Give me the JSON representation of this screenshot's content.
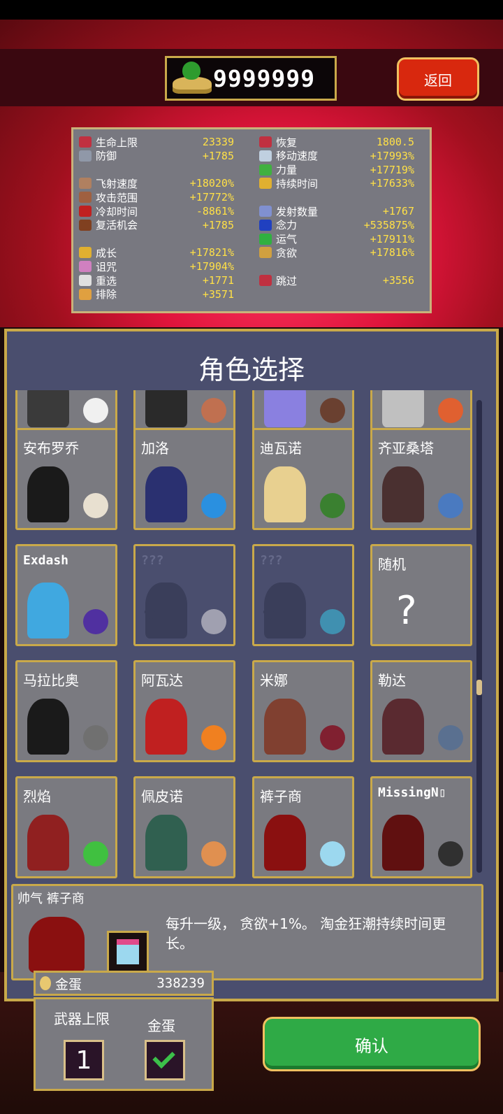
{
  "currency": {
    "value": "9999999",
    "icon": "gold-coin-bag-icon"
  },
  "back_label": "返回",
  "stats": {
    "left": [
      {
        "label": "生命上限",
        "value": "23339",
        "icon": "heart-icon",
        "color": "#c03040"
      },
      {
        "label": "防御",
        "value": "+1785",
        "icon": "armor-icon",
        "color": "#9098a8"
      },
      {
        "label": "飞射速度",
        "value": "+18020%",
        "icon": "wing-icon",
        "color": "#b08060"
      },
      {
        "label": "攻击范围",
        "value": "+17772%",
        "icon": "area-icon",
        "color": "#a06040"
      },
      {
        "label": "冷却时间",
        "value": "-8861%",
        "icon": "cooldown-icon",
        "color": "#c02020"
      },
      {
        "label": "复活机会",
        "value": "+1785",
        "icon": "revival-icon",
        "color": "#804020"
      },
      {
        "label": "成长",
        "value": "+17821%",
        "icon": "crown-icon",
        "color": "#e0b030"
      },
      {
        "label": "诅咒",
        "value": "+17904%",
        "icon": "skull-icon",
        "color": "#d080c0"
      },
      {
        "label": "重选",
        "value": "+1771",
        "icon": "dice-icon",
        "color": "#e0e0e0"
      },
      {
        "label": "排除",
        "value": "+3571",
        "icon": "banish-icon",
        "color": "#e0a040"
      }
    ],
    "right": [
      {
        "label": "恢复",
        "value": "1800.5",
        "icon": "recovery-heart-icon",
        "color": "#c03040"
      },
      {
        "label": "移动速度",
        "value": "+17993%",
        "icon": "wing-speed-icon",
        "color": "#c0d0e0"
      },
      {
        "label": "力量",
        "value": "+17719%",
        "icon": "leaf-icon",
        "color": "#40b040"
      },
      {
        "label": "持续时间",
        "value": "+17633%",
        "icon": "hourglass-icon",
        "color": "#e0b030"
      },
      {
        "label": "发射数量",
        "value": "+1767",
        "icon": "amount-icon",
        "color": "#8090d0"
      },
      {
        "label": "念力",
        "value": "+535875%",
        "icon": "magnet-icon",
        "color": "#2040c0"
      },
      {
        "label": "运气",
        "value": "+17911%",
        "icon": "clover-icon",
        "color": "#30b040"
      },
      {
        "label": "贪欲",
        "value": "+17816%",
        "icon": "greed-mask-icon",
        "color": "#d0a040"
      },
      {
        "label": "跳过",
        "value": "+3556",
        "icon": "skip-icon",
        "color": "#c03040"
      }
    ]
  },
  "panel_title": "角色选择",
  "characters": [
    {
      "name": "",
      "fig": "#3a3a3a",
      "item": "#f0f0f0"
    },
    {
      "name": "",
      "fig": "#2a2a2a",
      "item": "#c07050"
    },
    {
      "name": "",
      "fig": "#8a80e0",
      "item": "#6a4030"
    },
    {
      "name": "",
      "fig": "#c0c0c0",
      "item": "#e06030"
    },
    {
      "name": "安布罗乔",
      "fig": "#1a1a1a",
      "item": "#e8e0d0"
    },
    {
      "name": "加洛",
      "fig": "#2a3070",
      "item": "#2a90e0"
    },
    {
      "name": "迪瓦诺",
      "fig": "#e8d090",
      "item": "#3a8030"
    },
    {
      "name": "齐亚桑塔",
      "fig": "#4a3030",
      "item": "#4a7ac0"
    },
    {
      "name": "Exdash",
      "fig": "#40a8e0",
      "item": "#5030a0"
    },
    {
      "name": "???",
      "fig": "#3a3e5a",
      "item": "#a0a0b0",
      "dim": true
    },
    {
      "name": "???",
      "fig": "#3a3e5a",
      "item": "#4090b0",
      "dim": true
    },
    {
      "name": "随机",
      "random": true
    },
    {
      "name": "马拉比奥",
      "fig": "#1a1a1a",
      "item": "#707070"
    },
    {
      "name": "阿瓦达",
      "fig": "#c02020",
      "item": "#f08020"
    },
    {
      "name": "米娜",
      "fig": "#804030",
      "item": "#802030"
    },
    {
      "name": "勒达",
      "fig": "#5a2a30",
      "item": "#5a7090"
    },
    {
      "name": "烈焰",
      "fig": "#902020",
      "item": "#40c040"
    },
    {
      "name": "佩皮诺",
      "fig": "#306050",
      "item": "#e09050"
    },
    {
      "name": "裤子商",
      "fig": "#8a1010",
      "item": "#9cd8ef"
    },
    {
      "name": "MissingN▯",
      "fig": "#601010",
      "item": "#303030"
    }
  ],
  "selected": {
    "name": "帅气 裤子商",
    "description": "每升一级， 贪欲+1%。 淘金狂潮持续时间更长。",
    "icon": "gift-box-icon"
  },
  "golden_egg": {
    "label": "金蛋",
    "value": "338239"
  },
  "options": {
    "weapon_limit_label": "武器上限",
    "weapon_limit_value": "1",
    "golden_egg_label": "金蛋",
    "golden_egg_checked": true
  },
  "confirm_label": "确认"
}
